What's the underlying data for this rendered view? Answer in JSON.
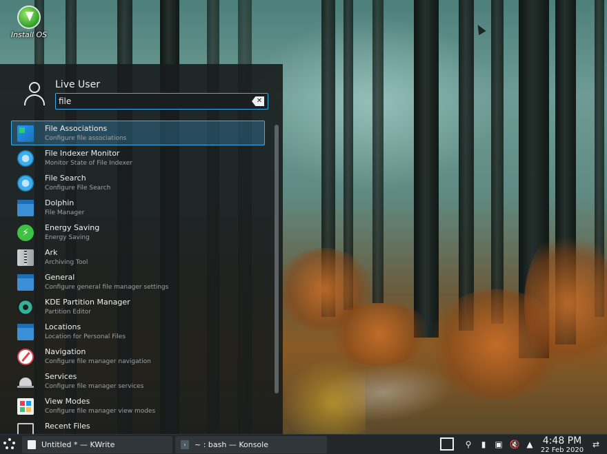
{
  "desktop": {
    "install_icon_label": "Install OS"
  },
  "launcher": {
    "user_name": "Live User",
    "search_value": "file",
    "clear_icon": "clear-text-icon",
    "results": [
      {
        "title": "File Associations",
        "subtitle": "Configure file associations",
        "icon": "file-associations-icon",
        "selected": true
      },
      {
        "title": "File Indexer Monitor",
        "subtitle": "Monitor State of File Indexer",
        "icon": "indexer-icon"
      },
      {
        "title": "File Search",
        "subtitle": "Configure File Search",
        "icon": "search-icon"
      },
      {
        "title": "Dolphin",
        "subtitle": "File Manager",
        "icon": "folder-icon"
      },
      {
        "title": "Energy Saving",
        "subtitle": "Energy Saving",
        "icon": "energy-icon"
      },
      {
        "title": "Ark",
        "subtitle": "Archiving Tool",
        "icon": "archive-icon"
      },
      {
        "title": "General",
        "subtitle": "Configure general file manager settings",
        "icon": "folder-icon"
      },
      {
        "title": "KDE Partition Manager",
        "subtitle": "Partition Editor",
        "icon": "partition-icon"
      },
      {
        "title": "Locations",
        "subtitle": "Location for Personal Files",
        "icon": "folder-icon"
      },
      {
        "title": "Navigation",
        "subtitle": "Configure file manager navigation",
        "icon": "compass-icon"
      },
      {
        "title": "Services",
        "subtitle": "Configure file manager services",
        "icon": "services-icon"
      },
      {
        "title": "View Modes",
        "subtitle": "Configure file manager view modes",
        "icon": "view-modes-icon"
      },
      {
        "title": "Recent Files",
        "subtitle": "",
        "icon": "recent-icon"
      }
    ]
  },
  "taskbar": {
    "tasks": [
      {
        "label": "Untitled * — KWrite",
        "icon": "kwrite-icon"
      },
      {
        "label": "~ : bash — Konsole",
        "icon": "konsole-icon"
      }
    ],
    "clock": {
      "time": "4:48 PM",
      "date": "22 Feb 2020"
    }
  },
  "colors": {
    "accent": "#3daee9",
    "panel": "#232729",
    "launcher_bg": "#181c1c"
  }
}
